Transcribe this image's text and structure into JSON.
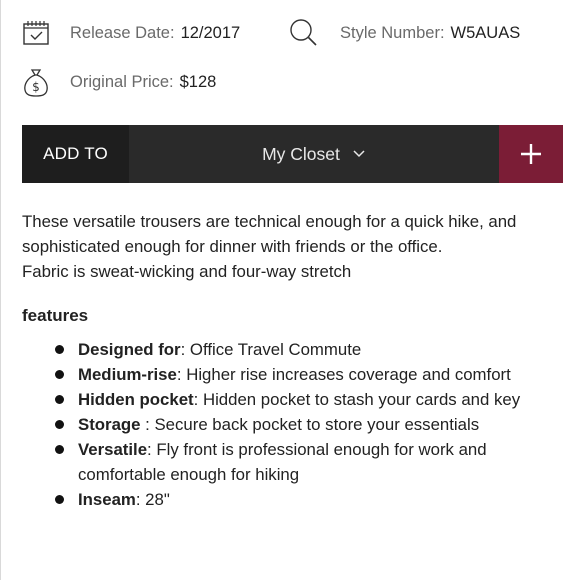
{
  "meta": {
    "release_label": "Release Date:",
    "release_value": "12/2017",
    "style_label": "Style Number:",
    "style_value": "W5AUAS",
    "price_label": "Original Price:",
    "price_value": "$128"
  },
  "icons": {
    "release": "calendar-check-icon",
    "style": "search-icon",
    "price": "money-bag-icon",
    "closet_chevron": "chevron-down-icon",
    "add": "plus-icon"
  },
  "add_bar": {
    "add_to_label": "ADD TO",
    "closet_value": "My Closet",
    "colors": {
      "label_bg": "#1e1e1e",
      "bar_bg": "#2a2a2a",
      "plus_bg": "#7b1d36"
    }
  },
  "description": {
    "line1": "These versatile trousers are technical enough for a quick hike, and sophisticated enough for dinner with friends or the office.",
    "line2": "Fabric is sweat-wicking and four-way stretch"
  },
  "features": {
    "heading": "features",
    "items": [
      {
        "name": "Designed for",
        "sep": ":",
        "text": " Office Travel Commute"
      },
      {
        "name": "Medium-rise",
        "sep": ":",
        "text": " Higher rise increases coverage and comfort"
      },
      {
        "name": "Hidden pocket",
        "sep": ":",
        "text": " Hidden pocket to stash your cards and key"
      },
      {
        "name": "Storage",
        "sep": " :",
        "text": " Secure back pocket to store your essentials"
      },
      {
        "name": "Versatile",
        "sep": ":",
        "text": " Fly front is professional enough for work and comfortable enough for hiking"
      },
      {
        "name": "Inseam",
        "sep": ":",
        "text": " 28\""
      }
    ]
  }
}
